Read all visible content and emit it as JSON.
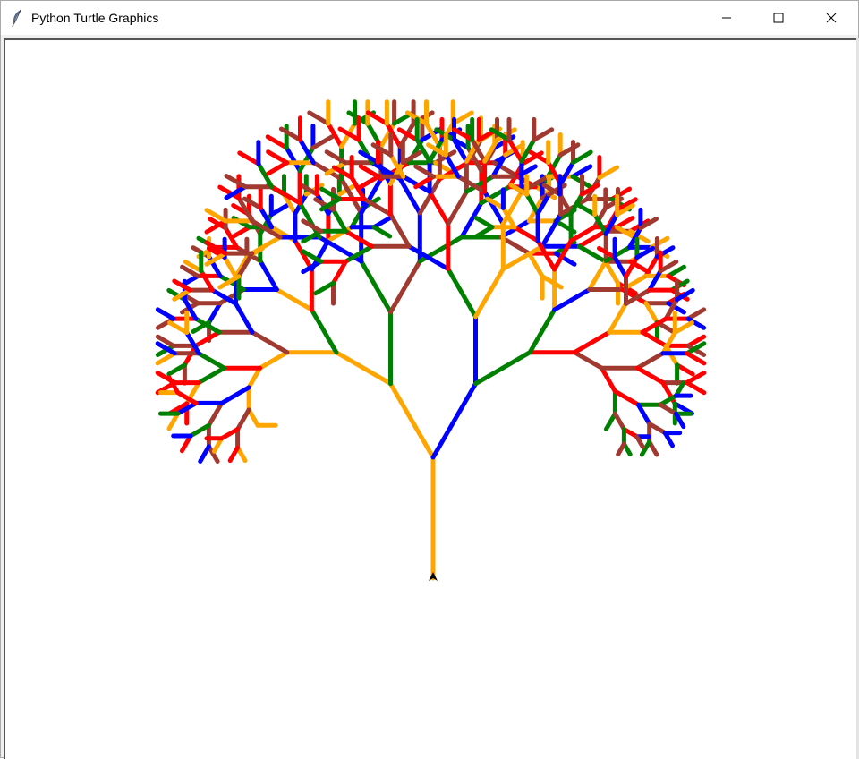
{
  "window": {
    "title": "Python Turtle Graphics",
    "icon": "feather-icon",
    "controls": [
      "minimize-icon",
      "maximize-icon",
      "close-icon"
    ]
  },
  "canvas": {
    "background": "#ffffff",
    "drawing": "fractal-tree",
    "colors": [
      "#ffa500",
      "#0000ff",
      "#008000",
      "#a0392f",
      "#ff0000"
    ],
    "cursor": "turtle-arrow-icon"
  }
}
